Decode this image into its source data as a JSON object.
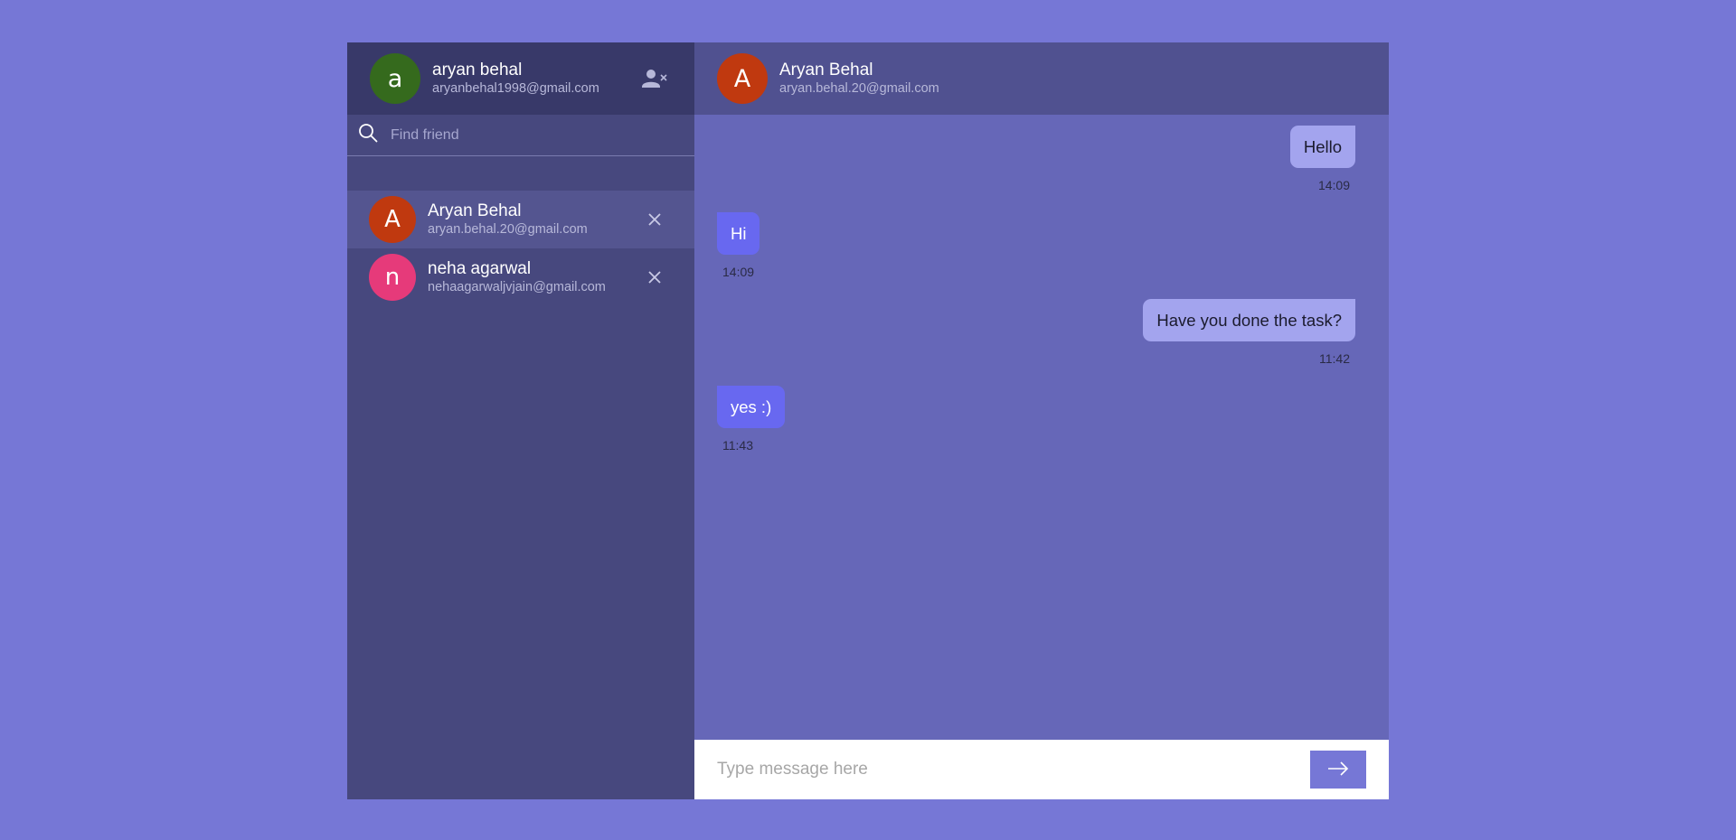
{
  "me": {
    "initial": "a",
    "name": "aryan behal",
    "email": "aryanbehal1998@gmail.com",
    "avatar_color": "#356a1d"
  },
  "search": {
    "placeholder": "Find friend"
  },
  "contacts": [
    {
      "initial": "A",
      "name": "Aryan Behal",
      "email": "aryan.behal.20@gmail.com",
      "avatar_color": "#c0390f",
      "active": true
    },
    {
      "initial": "n",
      "name": "neha agarwal",
      "email": "nehaagarwaljvjain@gmail.com",
      "avatar_color": "#e63a7a",
      "active": false
    }
  ],
  "chat": {
    "initial": "A",
    "name": "Aryan Behal",
    "email": "aryan.behal.20@gmail.com",
    "avatar_color": "#c0390f",
    "messages": [
      {
        "text": "Hello",
        "time": "14:09",
        "direction": "sent"
      },
      {
        "text": "Hi",
        "time": "14:09",
        "direction": "received"
      },
      {
        "text": "Have you done the task?",
        "time": "11:42",
        "direction": "sent"
      },
      {
        "text": "yes :)",
        "time": "11:43",
        "direction": "received"
      }
    ]
  },
  "composer": {
    "placeholder": "Type message here"
  },
  "colors": {
    "background": "#7677d6",
    "sidebar": "#47487e",
    "sidebar_header": "#383969",
    "chat": "#6667b8",
    "chat_header": "#505190",
    "sent_bubble": "#a3a4ee",
    "received_bubble": "#6868f0"
  },
  "icons": {
    "logout": "user-remove-icon",
    "search": "search-icon",
    "remove_contact": "close-icon",
    "send": "arrow-right-icon"
  }
}
